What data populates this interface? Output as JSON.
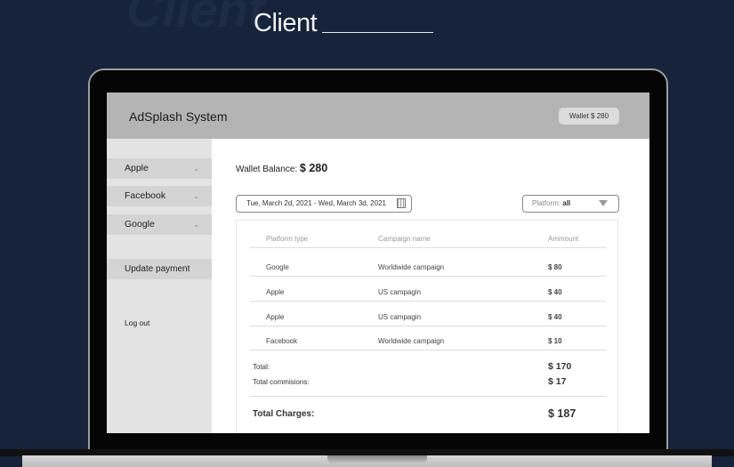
{
  "page": {
    "watermark": "Client",
    "title": "Client"
  },
  "app": {
    "brand": "AdSplash System",
    "wallet_button": "Wallet $ 280"
  },
  "sidebar": {
    "items": [
      {
        "label": "Apple"
      },
      {
        "label": "Facebook"
      },
      {
        "label": "Google"
      }
    ],
    "update_payment": "Update payment",
    "logout": "Log out"
  },
  "main": {
    "wallet_label": "Wallet Balance:",
    "wallet_value": "$ 280",
    "date_range": "Tue, March 2d, 2021 - Wed, March 3d, 2021",
    "platform_label": "Platform:",
    "platform_value": "all"
  },
  "table": {
    "headers": [
      "Platform type",
      "Campaign name",
      "Ammount"
    ],
    "rows": [
      [
        "Google",
        "Worldwide campaign",
        "$ 80"
      ],
      [
        "Apple",
        "US campagin",
        "$ 40"
      ],
      [
        "Apple",
        "US campagin",
        "$ 40"
      ],
      [
        "Facebook",
        "Worldwide campaign",
        "$ 10"
      ]
    ],
    "total_label": "Total:",
    "total_value": "$ 170",
    "commission_label": "Total commisions:",
    "commission_value": "$ 17",
    "charges_label": "Total Charges:",
    "charges_value": "$ 187"
  }
}
